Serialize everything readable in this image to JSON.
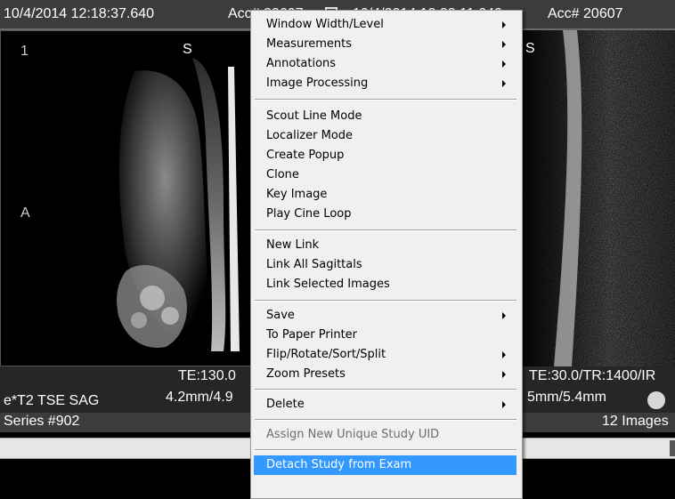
{
  "left_pane": {
    "date": "10/4/2014 12:18:37.640",
    "acc": "Acc# 20607",
    "image_number": "1",
    "orient_top": "S",
    "orient_left": "A",
    "te": "TE:130.0",
    "series_desc": "e*T2 TSE SAG",
    "thickness": "4.2mm/4.9",
    "series_number": "Series #902"
  },
  "right_pane": {
    "date": "10/4/2014 12:23:11.640",
    "acc": "Acc# 20607",
    "orient_top": "S",
    "te_tr": "TE:30.0/TR:1400/IR",
    "thickness": "5mm/5.4mm",
    "images": "12 Images"
  },
  "menu": {
    "items": [
      {
        "label": "Window Width/Level",
        "submenu": true
      },
      {
        "label": "Measurements",
        "submenu": true
      },
      {
        "label": "Annotations",
        "submenu": true
      },
      {
        "label": "Image Processing",
        "submenu": true
      },
      {
        "label": "Scout Line Mode",
        "submenu": false
      },
      {
        "label": "Localizer Mode",
        "submenu": false
      },
      {
        "label": "Create Popup",
        "submenu": false
      },
      {
        "label": "Clone",
        "submenu": false
      },
      {
        "label": "Key Image",
        "submenu": false
      },
      {
        "label": "Play Cine Loop",
        "submenu": false
      },
      {
        "label": "New Link",
        "submenu": false
      },
      {
        "label": "Link All Sagittals",
        "submenu": false
      },
      {
        "label": "Link Selected Images",
        "submenu": false
      },
      {
        "label": "Save",
        "submenu": true
      },
      {
        "label": "To Paper Printer",
        "submenu": false
      },
      {
        "label": "Flip/Rotate/Sort/Split",
        "submenu": true
      },
      {
        "label": "Zoom Presets",
        "submenu": true
      },
      {
        "label": "Delete",
        "submenu": true
      },
      {
        "label": "Assign New Unique Study UID",
        "submenu": false,
        "disabled": true
      },
      {
        "label": "Detach Study from Exam",
        "submenu": false,
        "highlighted": true
      }
    ]
  },
  "colors": {
    "header_bg": "#3c3c3c",
    "menu_bg": "#f0f0f0",
    "highlight": "#3399ff"
  }
}
